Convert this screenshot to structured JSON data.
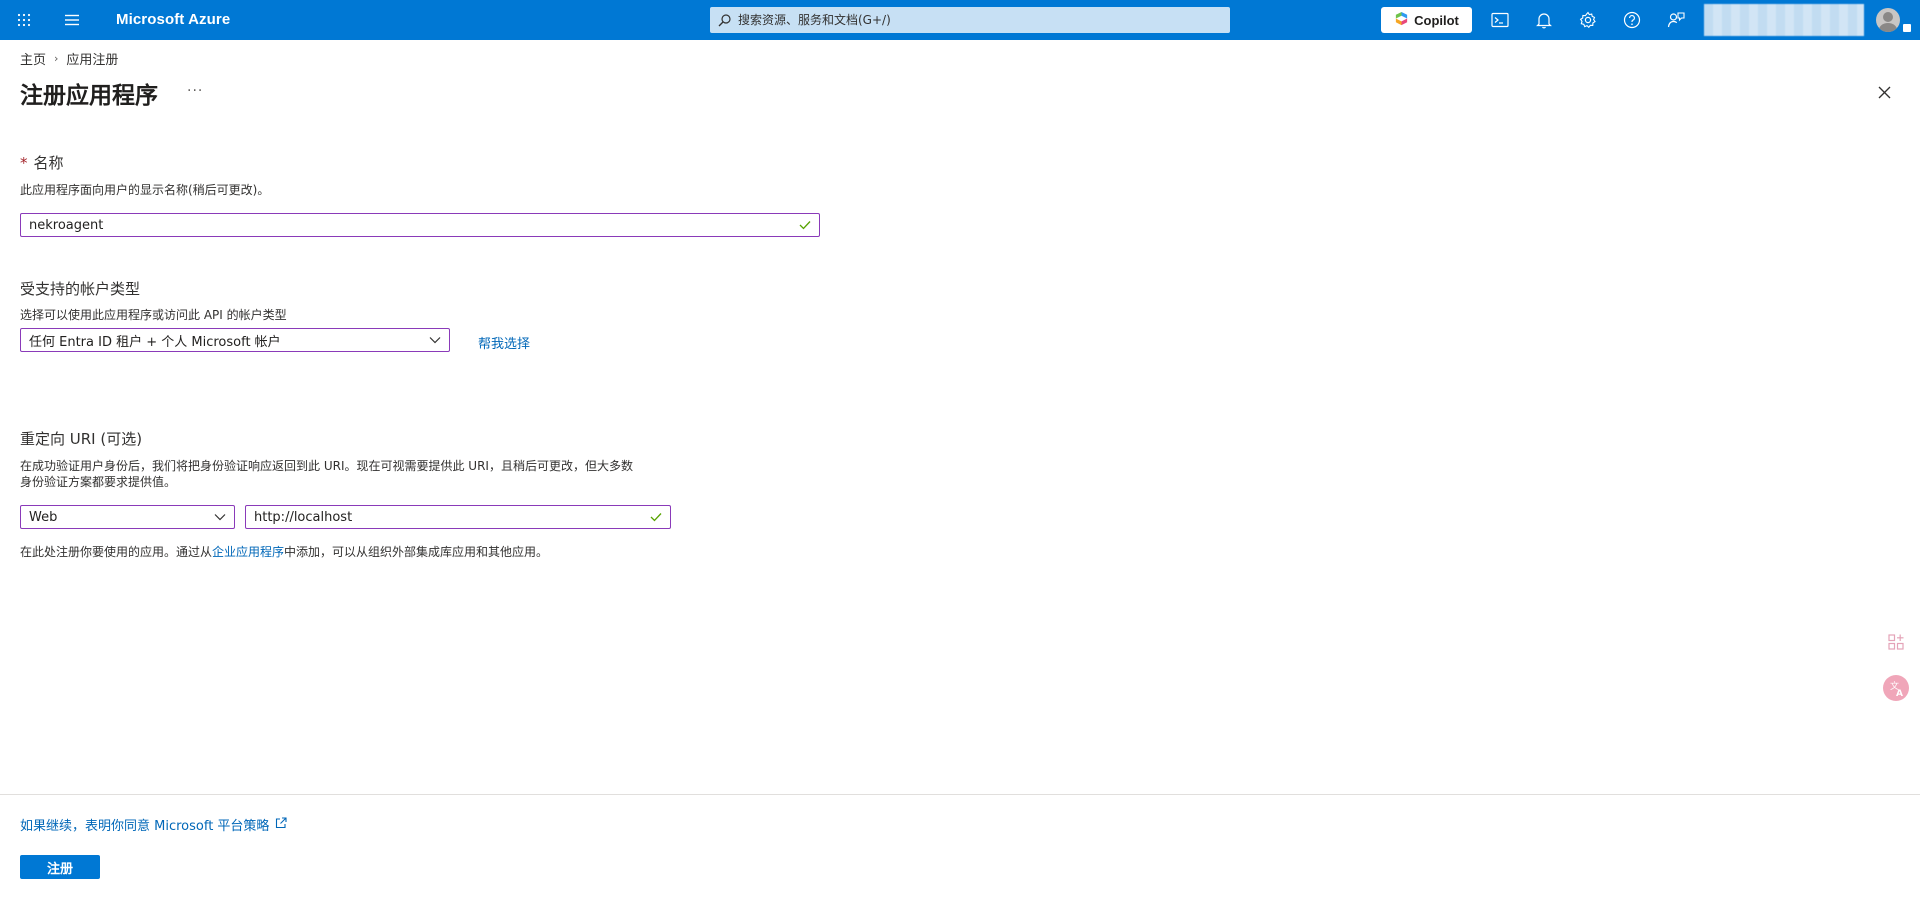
{
  "topbar": {
    "brand": "Microsoft Azure",
    "search_placeholder": "搜索资源、服务和文档(G+/)",
    "copilot_label": "Copilot"
  },
  "breadcrumb": {
    "home": "主页",
    "current": "应用注册"
  },
  "page": {
    "title": "注册应用程序",
    "more": "···"
  },
  "name_section": {
    "required_mark": "*",
    "title": "名称",
    "description": "此应用程序面向用户的显示名称(稍后可更改)。",
    "value": "nekroagent"
  },
  "account_section": {
    "title": "受支持的帐户类型",
    "description": "选择可以使用此应用程序或访问此 API 的帐户类型",
    "selected": "任何 Entra ID 租户 + 个人 Microsoft 帐户",
    "help_link": "帮我选择"
  },
  "redirect_section": {
    "title": "重定向 URI (可选)",
    "description_line1": "在成功验证用户身份后，我们将把身份验证响应返回到此 URI。现在可视需要提供此 URI，且稍后可更改，但大多数",
    "description_line2": "身份验证方案都要求提供值。",
    "platform": "Web",
    "uri_value": "http://localhost",
    "note_before": "在此处注册你要使用的应用。通过从",
    "note_link": "企业应用程序",
    "note_after": "中添加，可以从组织外部集成库应用和其他应用。"
  },
  "footer": {
    "policy_link": "如果继续，表明你同意 Microsoft 平台策略",
    "register_label": "注册"
  },
  "colors": {
    "topbar": "#0078d4",
    "focus_border": "#8a3ab9",
    "link": "#0067b8",
    "valid_check": "#57a300"
  }
}
